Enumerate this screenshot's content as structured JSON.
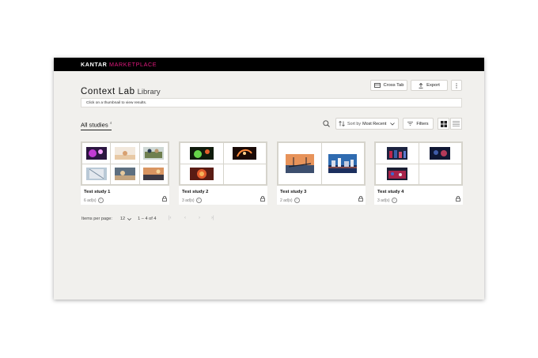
{
  "header": {
    "brand_primary": "KANTAR",
    "brand_secondary": "MARKETPLACE",
    "brand_color": "#e2197e"
  },
  "page": {
    "title": "Context Lab",
    "subtitle": "Library"
  },
  "toolbar": {
    "cross_tab": "Cross Tab",
    "export": "Export"
  },
  "hint_text": "Click on a thumbnail to view results.",
  "tabs": {
    "all_studies": "All studies",
    "all_studies_count": "4"
  },
  "sort": {
    "prefix": "Sort by",
    "value": "Most Recent"
  },
  "filters_label": "Filters",
  "studies": [
    {
      "name": "Test study 1",
      "count": "6 ad(s)"
    },
    {
      "name": "Test study 2",
      "count": "3 ad(s)"
    },
    {
      "name": "Test study 3",
      "count": "2 ad(s)"
    },
    {
      "name": "Test study 4",
      "count": "3 ad(s)"
    }
  ],
  "pagination": {
    "label": "Items per page:",
    "per_page": "12",
    "range": "1 – 4 of 4"
  },
  "icons": [
    "search-icon",
    "sort-icon",
    "chevron-down-icon",
    "filter-icon",
    "grid-view-icon",
    "list-view-icon",
    "info-icon",
    "lock-icon",
    "table-icon",
    "export-icon",
    "more-icon",
    "first-page-icon",
    "prev-page-icon",
    "next-page-icon",
    "last-page-icon"
  ]
}
